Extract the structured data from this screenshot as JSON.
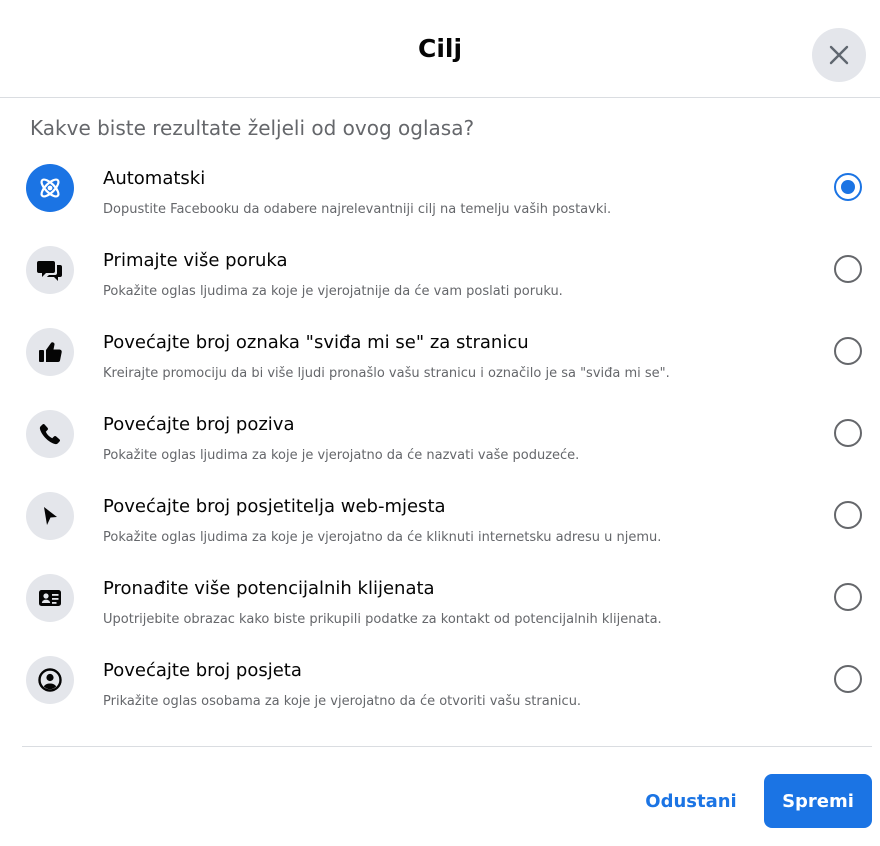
{
  "dialog": {
    "title": "Cilj",
    "close_icon": "close-icon"
  },
  "question": "Kakve biste rezultate željeli od ovog oglasa?",
  "options": [
    {
      "title": "Automatski",
      "description": "Dopustite Facebooku da odabere najrelevantniji cilj na temelju vaših postavki.",
      "icon": "atom-icon",
      "selected": true
    },
    {
      "title": "Primajte više poruka",
      "description": "Pokažite oglas ljudima za koje je vjerojatnije da će vam poslati poruku.",
      "icon": "chat-bubbles-icon",
      "selected": false
    },
    {
      "title": "Povećajte broj oznaka \"sviđa mi se\" za stranicu",
      "description": "Kreirajte promociju da bi više ljudi pronašlo vašu stranicu i označilo je sa \"sviđa mi se\".",
      "icon": "thumbs-up-icon",
      "selected": false
    },
    {
      "title": "Povećajte broj poziva",
      "description": "Pokažite oglas ljudima za koje je vjerojatno da će nazvati vaše poduzeće.",
      "icon": "phone-icon",
      "selected": false
    },
    {
      "title": "Povećajte broj posjetitelja web-mjesta",
      "description": "Pokažite oglas ljudima za koje je vjerojatno da će kliknuti internetsku adresu u njemu.",
      "icon": "cursor-icon",
      "selected": false
    },
    {
      "title": "Pronađite više potencijalnih klijenata",
      "description": "Upotrijebite obrazac kako biste prikupili podatke za kontakt od potencijalnih klijenata.",
      "icon": "contact-card-icon",
      "selected": false
    },
    {
      "title": "Povećajte broj posjeta",
      "description": "Prikažite oglas osobama za koje je vjerojatno da će otvoriti vašu stranicu.",
      "icon": "profile-icon",
      "selected": false
    }
  ],
  "footer": {
    "cancel_label": "Odustani",
    "save_label": "Spremi"
  },
  "colors": {
    "accent": "#1b74e4",
    "icon_bg": "#e4e6eb",
    "secondary_text": "#65676b"
  }
}
